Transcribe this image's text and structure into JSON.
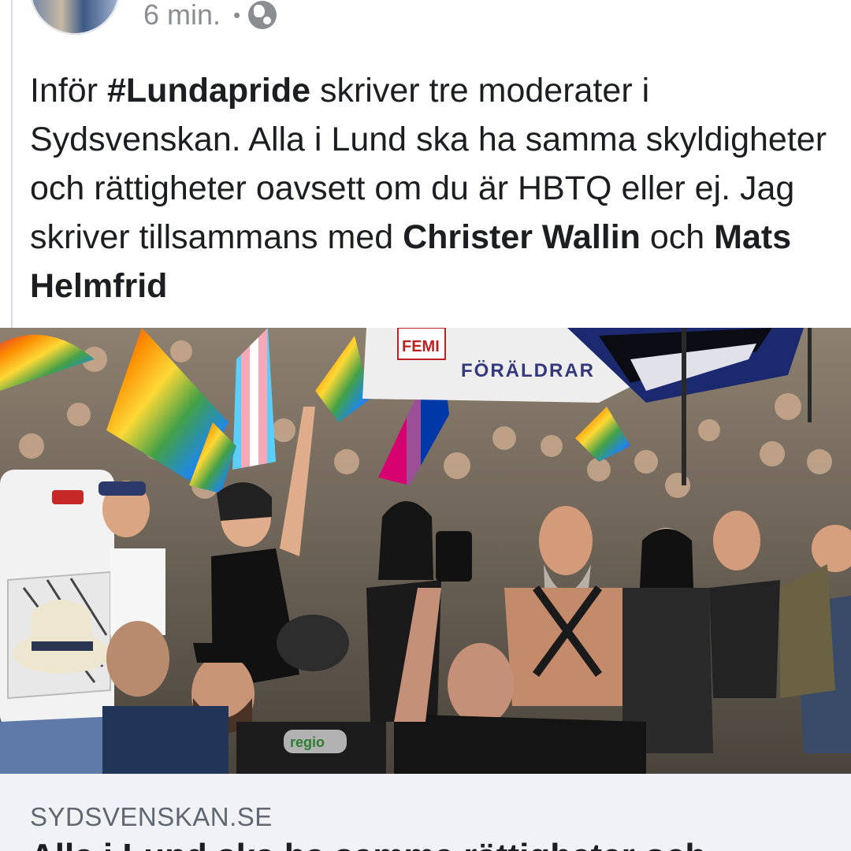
{
  "post": {
    "time": "6 min.",
    "separator": "•",
    "privacy_icon": "globe-icon",
    "text": {
      "intro": "Inför ",
      "hashtag": "#Lundapride",
      "part1": " skriver tre moderater i Sydsvenskan. Alla i Lund ska ha samma skyldigheter och rättigheter oavsett om du är HBTQ eller ej. Jag skriver tillsammans med ",
      "mention1": "Christer Wallin",
      "connector": " och ",
      "mention2": "Mats Helmfrid"
    }
  },
  "photo": {
    "banner_text": "FÖRÄLDRAR",
    "sign_text": "FEMI",
    "hat_text": "regio"
  },
  "link_preview": {
    "domain": "SYDSVENSKAN.SE",
    "title": "Alla i Lund ska ha samma rättigheter och"
  }
}
